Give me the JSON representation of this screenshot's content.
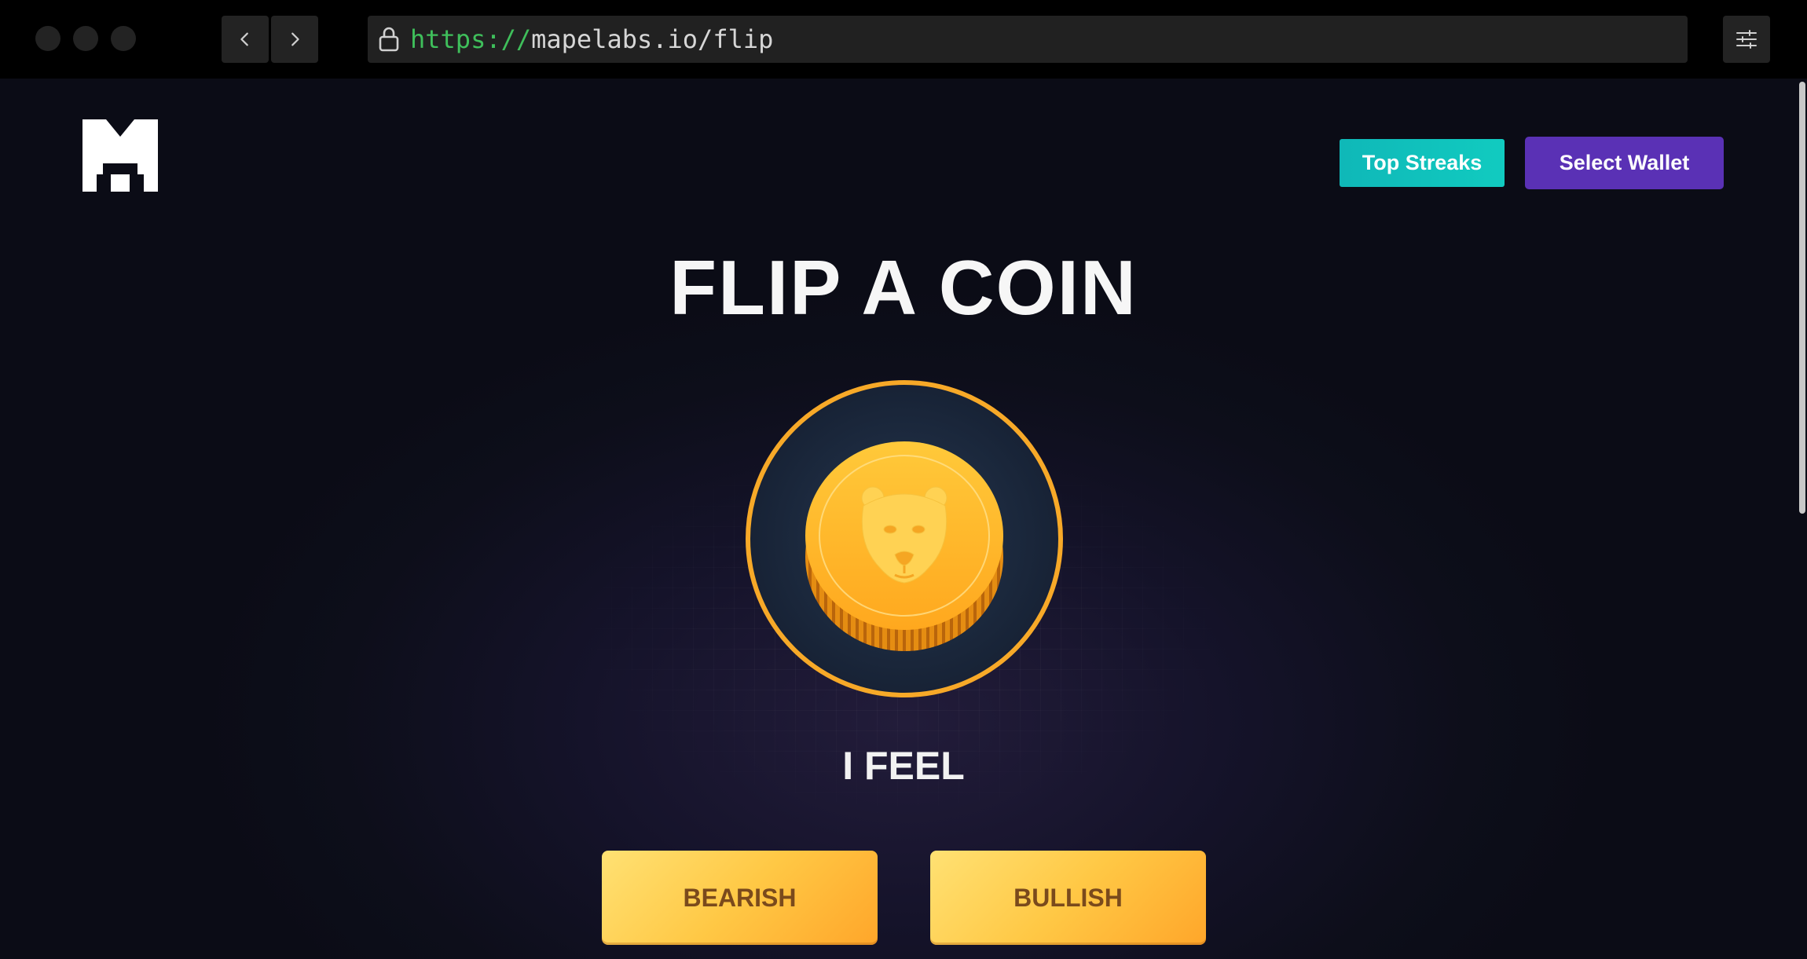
{
  "browser": {
    "url_scheme": "https://",
    "url_rest": "mapelabs.io/flip",
    "icons": [
      "chevron-left-icon",
      "chevron-right-icon",
      "lock-icon",
      "sliders-icon"
    ]
  },
  "header": {
    "logo": "mapelabs-logo",
    "top_streaks_label": "Top Streaks",
    "select_wallet_label": "Select Wallet"
  },
  "main": {
    "title": "FLIP A COIN",
    "coin_icon": "bear-icon",
    "prompt": "I FEEL",
    "bearish_label": "BEARISH",
    "bullish_label": "BULLISH"
  },
  "colors": {
    "accent_teal": "#11c2bd",
    "accent_purple": "#5a31b5",
    "coin_gold": "#ffb62e",
    "coin_ring": "#f5a623",
    "button_gradient_start": "#ffe173",
    "button_gradient_end": "#ffa62a"
  }
}
